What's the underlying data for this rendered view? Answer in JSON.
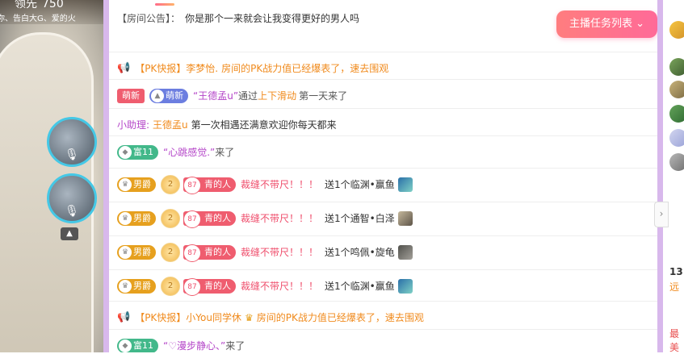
{
  "video": {
    "score_label": "领先",
    "score_value": "750",
    "marquee": "你、告白大G、爱的火"
  },
  "mic_seats": [
    {
      "icon": "🎙"
    },
    {
      "icon": "🎙"
    }
  ],
  "announcement": {
    "label": "【房间公告】：",
    "text": "你是那个一来就会让我变得更好的男人吗"
  },
  "task_button": "主播任务列表",
  "pk_news_1": {
    "tag": "【PK快报】",
    "name": "李梦怡.",
    "text": "房间的PK战力值已经爆表了，速去围观"
  },
  "enter_1": {
    "badge1": "萌新",
    "badge2": "萌新",
    "user": "“王德孟u”",
    "via": "通过",
    "action": "上下滑动",
    "suffix": "第一天来了"
  },
  "assistant": {
    "label": "小助理:",
    "name": "王德孟u",
    "text": "第一次相遇还满意欢迎你每天都来"
  },
  "enter_2": {
    "badge": "富11",
    "user": "“心跳感觉.”",
    "suffix": "来了"
  },
  "gift_rows": [
    {
      "noble": "男爵",
      "level": "2",
      "fan_num": "87",
      "fan_name": "青的人",
      "user": "裁缝不带尺！！！",
      "text": "送1个临渊•赢鱼"
    },
    {
      "noble": "男爵",
      "level": "2",
      "fan_num": "87",
      "fan_name": "青的人",
      "user": "裁缝不带尺！！！",
      "text": "送1个通智•白泽"
    },
    {
      "noble": "男爵",
      "level": "2",
      "fan_num": "87",
      "fan_name": "青的人",
      "user": "裁缝不带尺！！！",
      "text": "送1个鸣佩•旋龟"
    },
    {
      "noble": "男爵",
      "level": "2",
      "fan_num": "87",
      "fan_name": "青的人",
      "user": "裁缝不带尺！！！",
      "text": "送1个临渊•赢鱼"
    }
  ],
  "pk_news_2": {
    "tag": "【PK快报】",
    "name": "小You同学休",
    "text": "房间的PK战力值已经爆表了，速去围观"
  },
  "enter_3": {
    "badge": "富11",
    "user": "“♡漫步静心、”",
    "suffix": "来了"
  },
  "right_column": {
    "text1": "13",
    "text2": "远",
    "text3": "最美"
  },
  "colors": {
    "accent_pink": "#ff6a98",
    "orange": "#f08a1c",
    "purple": "#b445c8",
    "border_lilac": "#d8b8ec"
  }
}
